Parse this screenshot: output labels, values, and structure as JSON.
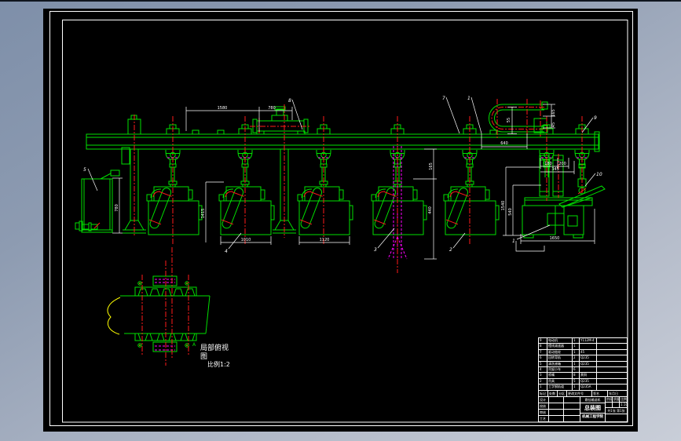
{
  "colors": {
    "g": "#00e000",
    "r": "#ff1a1a",
    "m": "#ff00ff",
    "y": "#ffff00",
    "w": "#ffffff"
  },
  "detail": {
    "line1": "局部俯视",
    "line2": "图",
    "scale": "比例1:2"
  },
  "section_label": "A",
  "balloons": {
    "b5": "5",
    "b8": "8",
    "b7": "7",
    "b1a": "1",
    "b9": "9",
    "b10": "10",
    "b1b": "1",
    "b4": "4",
    "b3": "3",
    "b2": "2"
  },
  "dims": {
    "rail_span_left": "1580",
    "rail_span_right": "780",
    "utube_width": "640",
    "utube_gap": "55",
    "utube_h_upper": "165",
    "utube_h_lower": "45",
    "carriage_height": "1415",
    "box1_width": "1010",
    "box2_width": "1120",
    "nozzle_offset": "165",
    "nozzle_drop": "440",
    "tank_height": "780",
    "drive_pitch_left": "180",
    "drive_pitch_right": "200",
    "drive_span": "345",
    "drive_h_outer": "1540",
    "drive_h_inner": "540",
    "drive_width": "1650"
  },
  "title_block": {
    "parts_rows": [
      [
        "9",
        "电动机",
        "1",
        "Y112M-4",
        ""
      ],
      [
        "8",
        "摆线减速器",
        "1",
        "",
        ""
      ],
      [
        "7",
        "驱动链轮",
        "1",
        "45",
        ""
      ],
      [
        "6",
        "回转弯轨",
        "2",
        "Q235",
        ""
      ],
      [
        "5",
        "清洗液箱",
        "1",
        "Q235",
        ""
      ],
      [
        "4",
        "吊架小车",
        "6",
        "",
        ""
      ],
      [
        "3",
        "喷嘴",
        "8",
        "黄铜",
        ""
      ],
      [
        "2",
        "吊具",
        "5",
        "Q235",
        ""
      ],
      [
        "1",
        "工字钢轨道",
        "1",
        "Q235A",
        ""
      ]
    ],
    "change_row": [
      "标记",
      "处数",
      "分区",
      "更改文件号",
      "签名",
      "年月日"
    ],
    "sign_rows": [
      [
        "设计",
        "",
        ""
      ],
      [
        "校核",
        "",
        ""
      ],
      [
        "审核",
        "",
        ""
      ],
      [
        "工艺",
        "",
        ""
      ]
    ],
    "product": "悬挂输送机",
    "title": "总装图",
    "org": "机械工程学院",
    "right_labels": [
      "阶段标记",
      "质量",
      "比例"
    ],
    "right_values": [
      "",
      "",
      "1:10"
    ],
    "sheet": "共1张 第1张"
  }
}
